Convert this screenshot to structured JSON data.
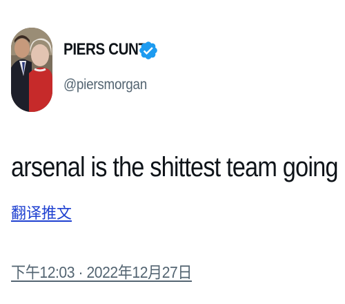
{
  "author": {
    "display_name": "PIERS CUNT",
    "handle": "@piersmorgan",
    "verified_icon": "verified-badge-icon",
    "verified_color": "#1d9bf0"
  },
  "tweet": {
    "text": "arsenal is the shittest team going",
    "translate_label": "翻译推文",
    "timestamp": "下午12:03 · 2022年12月27日"
  },
  "colors": {
    "text_primary": "#0f1419",
    "text_secondary": "#536471",
    "link": "#1d3fd0"
  }
}
